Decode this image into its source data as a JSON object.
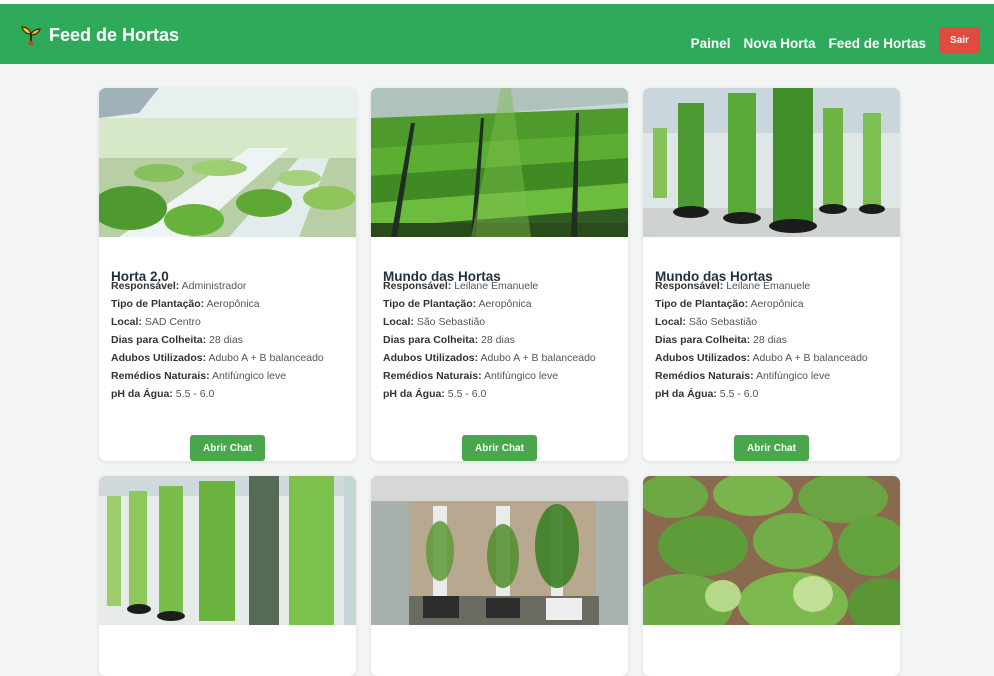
{
  "navbar": {
    "brand": "Feed de Hortas",
    "brand_icon": "sprout-icon",
    "links": [
      "Painel",
      "Nova Horta",
      "Feed de Hortas"
    ],
    "logout_label": "Sair",
    "colors": {
      "bar": "#2eaa5a",
      "logout": "#e04a3f"
    }
  },
  "labels": {
    "responsavel": "Responsável:",
    "tipo": "Tipo de Plantação:",
    "local": "Local:",
    "dias": "Dias para Colheita:",
    "adubos": "Adubos Utilizados:",
    "remedios": "Remédios Naturais:",
    "ph": "pH da Água:"
  },
  "cards": [
    {
      "title": "Horta 2.0",
      "responsavel": "Administrador",
      "tipo": "Aeropônica",
      "local": "SAD Centro",
      "dias": "28 dias",
      "adubos": "Adubo A + B balanceado",
      "remedios": "Antifúngico leve",
      "ph": "5.5 - 6.0",
      "button": "Abrir Chat"
    },
    {
      "title": "Mundo das Hortas",
      "responsavel": "Leilane Emanuele",
      "tipo": "Aeropônica",
      "local": "São Sebastião",
      "dias": "28 dias",
      "adubos": "Adubo A + B balanceado",
      "remedios": "Antifúngico leve",
      "ph": "5.5 - 6.0",
      "button": "Abrir Chat"
    },
    {
      "title": "Mundo das Hortas",
      "responsavel": "Leilane Emanuele",
      "tipo": "Aeropônica",
      "local": "São Sebastião",
      "dias": "28 dias",
      "adubos": "Adubo A + B balanceado",
      "remedios": "Antifúngico leve",
      "ph": "5.5 - 6.0",
      "button": "Abrir Chat"
    }
  ],
  "button_color": "#49a84c"
}
